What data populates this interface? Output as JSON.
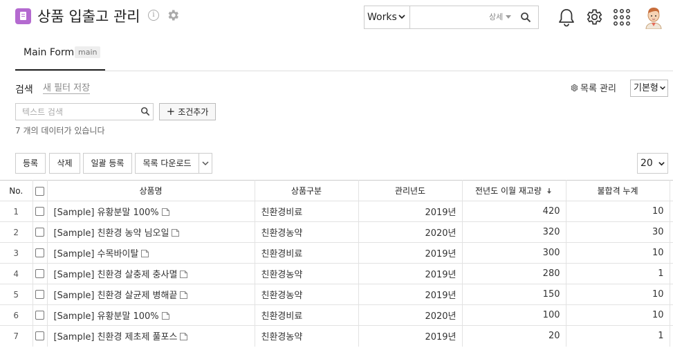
{
  "header": {
    "title": "상품 입출고 관리",
    "info_glyph": "i",
    "search": {
      "scope": "Works",
      "query": "",
      "detail_label": "상세"
    }
  },
  "tabs": [
    {
      "label": "Main Form",
      "badge": "main"
    }
  ],
  "filter": {
    "title": "검색",
    "save_filter": "새 필터 저장",
    "list_manage": "목록 관리",
    "view_type": "기본형",
    "text_search_placeholder": "텍스트 검색",
    "add_condition": "조건추가",
    "add_glyph": "+",
    "record_count": "7 개의 데이터가 있습니다"
  },
  "toolbar": {
    "register": "등록",
    "delete": "삭제",
    "bulk_register": "일괄 등록",
    "download": "목록 다운로드",
    "page_size": "20"
  },
  "table": {
    "columns": {
      "no": "No.",
      "name": "상품명",
      "category": "상품구분",
      "year": "관리년도",
      "stock": "전년도 이월 재고량",
      "defects": "불합격 누계"
    },
    "rows": [
      {
        "no": "1",
        "name": "[Sample] 유황분말 100%",
        "category": "친환경비료",
        "year": "2019년",
        "stock": "420",
        "defects": "10"
      },
      {
        "no": "2",
        "name": "[Sample] 친환경 농약 님오일",
        "category": "친환경농약",
        "year": "2020년",
        "stock": "320",
        "defects": "30"
      },
      {
        "no": "3",
        "name": "[Sample] 수목바이탈",
        "category": "친환경비료",
        "year": "2019년",
        "stock": "300",
        "defects": "10"
      },
      {
        "no": "4",
        "name": "[Sample] 친환경 살충제 충사멸",
        "category": "친환경농약",
        "year": "2019년",
        "stock": "280",
        "defects": "1"
      },
      {
        "no": "5",
        "name": "[Sample] 친환경 살균제 병해끝",
        "category": "친환경농약",
        "year": "2019년",
        "stock": "150",
        "defects": "10"
      },
      {
        "no": "6",
        "name": "[Sample] 유황분말 100%",
        "category": "친환경비료",
        "year": "2020년",
        "stock": "100",
        "defects": "10"
      },
      {
        "no": "7",
        "name": "[Sample] 친환경 제초제 풀포스",
        "category": "친환경농약",
        "year": "2019년",
        "stock": "20",
        "defects": "1"
      }
    ]
  },
  "colors": {
    "app_icon": "#b46ad0",
    "tab_underline": "#222222",
    "border": "#e2e2e2"
  },
  "icons": {
    "app": "document-icon",
    "info": "info-icon",
    "settings": "gear-icon",
    "search": "search-icon",
    "notifications": "bell-icon",
    "apps": "grid-icon",
    "user": "avatar",
    "row_link": "open-document-icon",
    "sort": "sort-desc-icon"
  }
}
